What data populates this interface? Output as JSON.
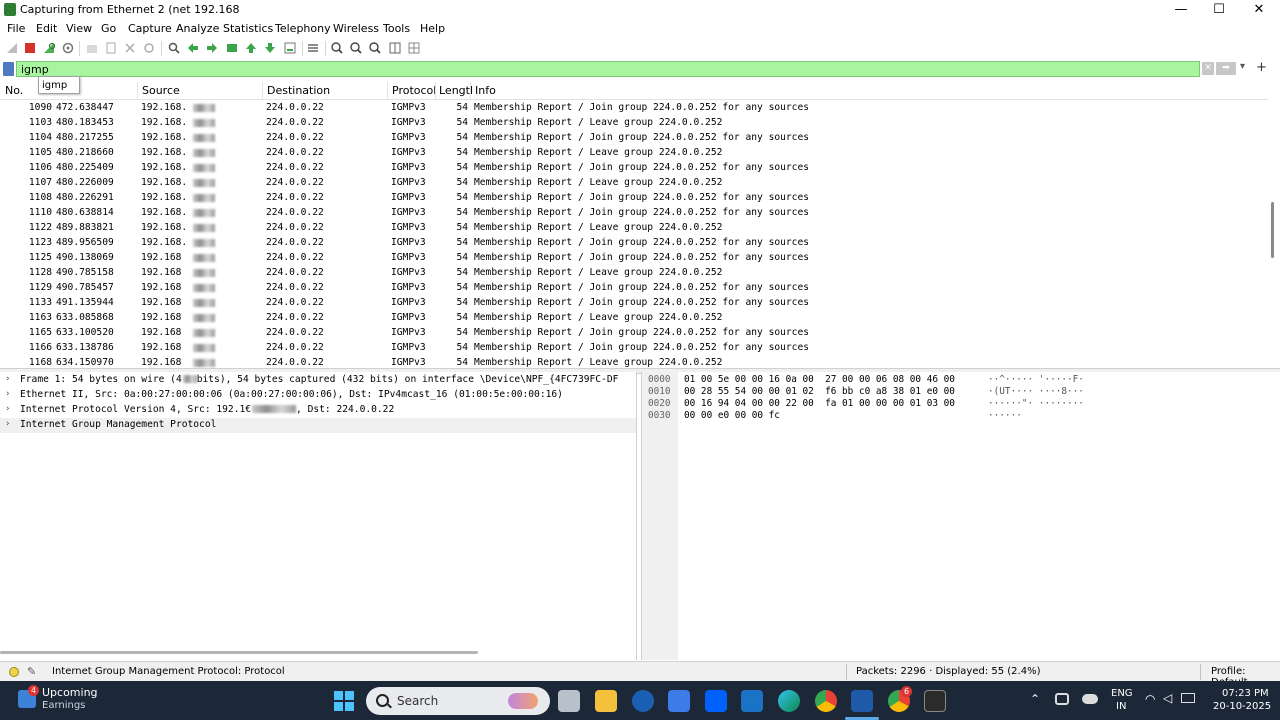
{
  "window": {
    "title": "Capturing from Ethernet 2 (net 192.168",
    "minimize": "—",
    "maximize": "☐",
    "close": "✕"
  },
  "menu": [
    "File",
    "Edit",
    "View",
    "Go",
    "Capture",
    "Analyze",
    "Statistics",
    "Telephony",
    "Wireless",
    "Tools",
    "Help"
  ],
  "toolbar": {
    "icons": [
      "shark-fin-start-icon",
      "stop-capture-icon",
      "restart-capture-icon",
      "capture-options-icon",
      "open-file-icon",
      "save-file-icon",
      "close-file-icon",
      "reload-file-icon",
      "find-packet-icon",
      "go-back-icon",
      "go-forward-icon",
      "go-to-packet-icon",
      "go-first-icon",
      "go-last-icon",
      "auto-scroll-icon",
      "colorize-icon",
      "zoom-in-icon",
      "zoom-out-icon",
      "zoom-reset-icon",
      "resize-columns-icon",
      "layout-icon"
    ]
  },
  "filter": {
    "value": "igmp",
    "autocomplete": "igmp",
    "clear_icon": "✕",
    "apply_icon": "➡",
    "dropdown_icon": "▾",
    "add_icon": "+"
  },
  "packet_list": {
    "columns": [
      "No.",
      "Source",
      "Destination",
      "Protocol",
      "Lengtl",
      "Info"
    ],
    "rows": [
      {
        "no": "1090",
        "time": "472.638447",
        "src": "192.168.",
        "dst": "224.0.0.22",
        "proto": "IGMPv3",
        "len": "54",
        "info": "Membership Report / Join group 224.0.0.252 for any sources"
      },
      {
        "no": "1103",
        "time": "480.183453",
        "src": "192.168.",
        "dst": "224.0.0.22",
        "proto": "IGMPv3",
        "len": "54",
        "info": "Membership Report / Leave group 224.0.0.252"
      },
      {
        "no": "1104",
        "time": "480.217255",
        "src": "192.168.",
        "dst": "224.0.0.22",
        "proto": "IGMPv3",
        "len": "54",
        "info": "Membership Report / Join group 224.0.0.252 for any sources"
      },
      {
        "no": "1105",
        "time": "480.218660",
        "src": "192.168.",
        "dst": "224.0.0.22",
        "proto": "IGMPv3",
        "len": "54",
        "info": "Membership Report / Leave group 224.0.0.252"
      },
      {
        "no": "1106",
        "time": "480.225409",
        "src": "192.168.",
        "dst": "224.0.0.22",
        "proto": "IGMPv3",
        "len": "54",
        "info": "Membership Report / Join group 224.0.0.252 for any sources"
      },
      {
        "no": "1107",
        "time": "480.226009",
        "src": "192.168.",
        "dst": "224.0.0.22",
        "proto": "IGMPv3",
        "len": "54",
        "info": "Membership Report / Leave group 224.0.0.252"
      },
      {
        "no": "1108",
        "time": "480.226291",
        "src": "192.168.",
        "dst": "224.0.0.22",
        "proto": "IGMPv3",
        "len": "54",
        "info": "Membership Report / Join group 224.0.0.252 for any sources"
      },
      {
        "no": "1110",
        "time": "480.638814",
        "src": "192.168.",
        "dst": "224.0.0.22",
        "proto": "IGMPv3",
        "len": "54",
        "info": "Membership Report / Join group 224.0.0.252 for any sources"
      },
      {
        "no": "1122",
        "time": "489.883821",
        "src": "192.168.",
        "dst": "224.0.0.22",
        "proto": "IGMPv3",
        "len": "54",
        "info": "Membership Report / Leave group 224.0.0.252"
      },
      {
        "no": "1123",
        "time": "489.956509",
        "src": "192.168.",
        "dst": "224.0.0.22",
        "proto": "IGMPv3",
        "len": "54",
        "info": "Membership Report / Join group 224.0.0.252 for any sources"
      },
      {
        "no": "1125",
        "time": "490.138069",
        "src": "192.168",
        "dst": "224.0.0.22",
        "proto": "IGMPv3",
        "len": "54",
        "info": "Membership Report / Join group 224.0.0.252 for any sources"
      },
      {
        "no": "1128",
        "time": "490.785158",
        "src": "192.168",
        "dst": "224.0.0.22",
        "proto": "IGMPv3",
        "len": "54",
        "info": "Membership Report / Leave group 224.0.0.252"
      },
      {
        "no": "1129",
        "time": "490.785457",
        "src": "192.168",
        "dst": "224.0.0.22",
        "proto": "IGMPv3",
        "len": "54",
        "info": "Membership Report / Join group 224.0.0.252 for any sources"
      },
      {
        "no": "1133",
        "time": "491.135944",
        "src": "192.168",
        "dst": "224.0.0.22",
        "proto": "IGMPv3",
        "len": "54",
        "info": "Membership Report / Join group 224.0.0.252 for any sources"
      },
      {
        "no": "1163",
        "time": "633.085868",
        "src": "192.168",
        "dst": "224.0.0.22",
        "proto": "IGMPv3",
        "len": "54",
        "info": "Membership Report / Leave group 224.0.0.252"
      },
      {
        "no": "1165",
        "time": "633.100520",
        "src": "192.168",
        "dst": "224.0.0.22",
        "proto": "IGMPv3",
        "len": "54",
        "info": "Membership Report / Join group 224.0.0.252 for any sources"
      },
      {
        "no": "1166",
        "time": "633.138786",
        "src": "192.168",
        "dst": "224.0.0.22",
        "proto": "IGMPv3",
        "len": "54",
        "info": "Membership Report / Join group 224.0.0.252 for any sources"
      },
      {
        "no": "1168",
        "time": "634.150970",
        "src": "192.168",
        "dst": "224.0.0.22",
        "proto": "IGMPv3",
        "len": "54",
        "info": "Membership Report / Leave group 224.0.0.252"
      }
    ]
  },
  "details": [
    {
      "text": "Frame 1: 54 bytes on wire (4",
      "suffix": "bits), 54 bytes captured (432 bits) on interface \\Device\\NPF_{4FC739FC-DF"
    },
    {
      "text": "Ethernet II, Src: 0a:00:27:00:00:06 (0a:00:27:00:00:06), Dst: IPv4mcast_16 (01:00:5e:00:00:16)",
      "suffix": ""
    },
    {
      "text": "Internet Protocol Version 4, Src: 192.1€",
      "suffix": ", Dst: 224.0.0.22"
    },
    {
      "text": "Internet Group Management Protocol",
      "suffix": ""
    }
  ],
  "bytes": [
    {
      "off": "0000",
      "hex": "01 00 5e 00 00 16 0a 00  27 00 00 06 08 00 46 00",
      "ascii": "··^····· '·····F·"
    },
    {
      "off": "0010",
      "hex": "00 28 55 54 00 00 01 02  f6 bb c0 a8 38 01 e0 00",
      "ascii": "·(UT···· ····8···"
    },
    {
      "off": "0020",
      "hex": "00 16 94 04 00 00 22 00  fa 01 00 00 00 01 03 00",
      "ascii": "······\"· ········"
    },
    {
      "off": "0030",
      "hex": "00 00 e0 00 00 fc",
      "ascii": "······"
    }
  ],
  "status": {
    "text": "Internet Group Management Protocol: Protocol",
    "packets": "Packets: 2296 · Displayed: 55 (2.4%)",
    "profile": "Profile: Default"
  },
  "taskbar": {
    "weather_title": "Upcoming",
    "weather_sub": "Earnings",
    "weather_badge": "4",
    "search": "Search",
    "chrome_badge": "6",
    "lang1": "ENG",
    "lang2": "IN",
    "time": "07:23 PM",
    "date": "20-10-2025"
  },
  "colors": {
    "filter_bg": "#a8f5a0",
    "taskbar_bg": "#1c2738",
    "stop_red": "#d9302b"
  }
}
